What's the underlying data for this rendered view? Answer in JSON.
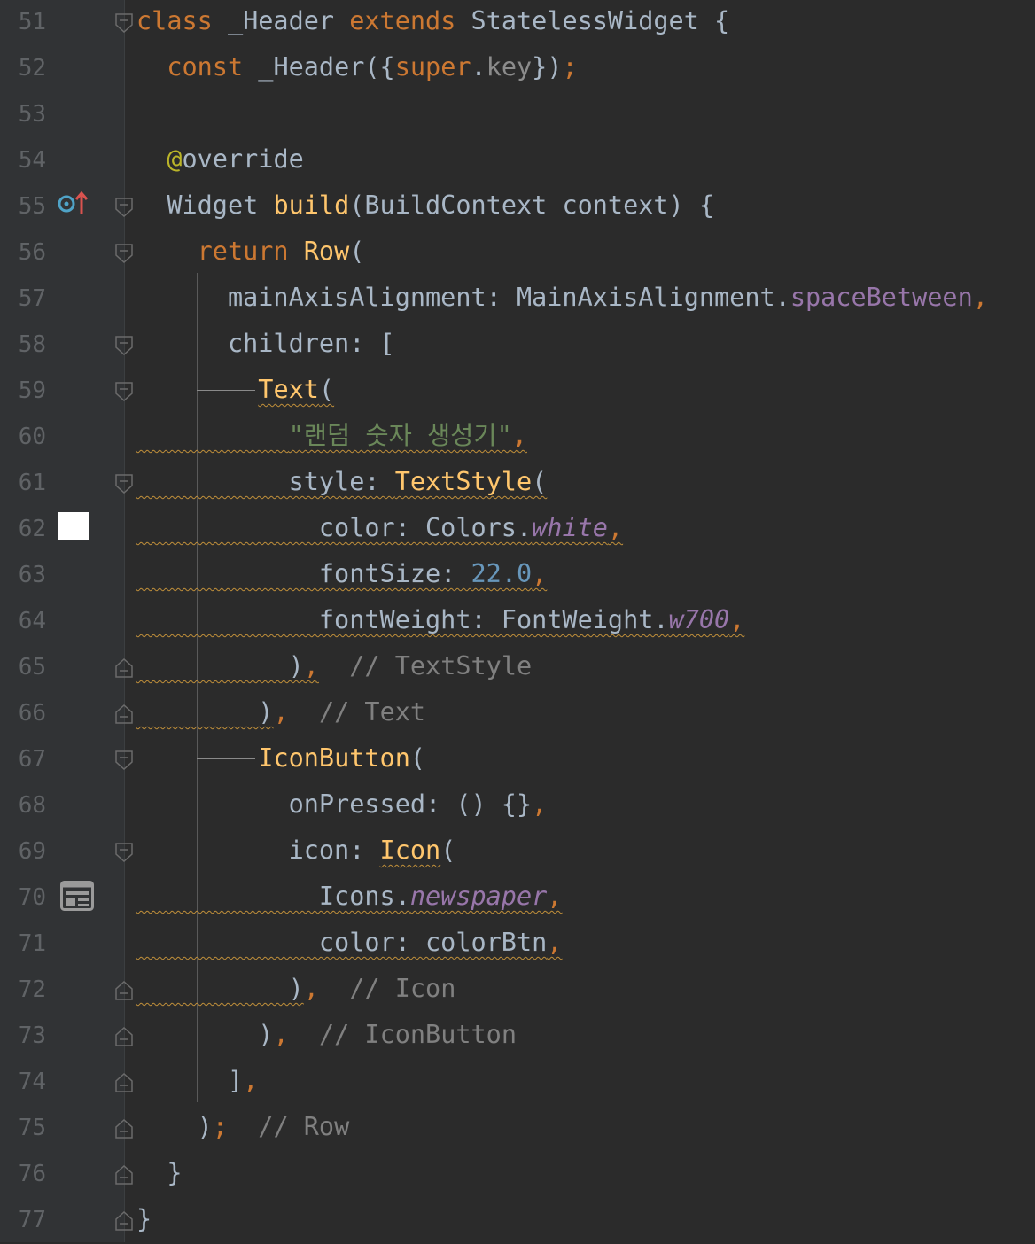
{
  "editor": {
    "language": "dart",
    "lines": [
      {
        "number": "51",
        "tokens": [
          [
            "cls_kw",
            "class"
          ],
          [
            "plain",
            " _Header "
          ],
          [
            "kw",
            "extends"
          ],
          [
            "plain",
            " StatelessWidget {"
          ]
        ]
      },
      {
        "number": "52",
        "tokens": [
          [
            "plain",
            "  "
          ],
          [
            "kw",
            "const"
          ],
          [
            "plain",
            " _Header({"
          ],
          [
            "kw",
            "super"
          ],
          [
            "plain",
            "."
          ],
          [
            "grey",
            "key"
          ],
          [
            "plain",
            "})"
          ],
          [
            "punc",
            ";"
          ]
        ]
      },
      {
        "number": "53",
        "tokens": []
      },
      {
        "number": "54",
        "tokens": [
          [
            "plain",
            "  "
          ],
          [
            "anno",
            "@"
          ],
          [
            "plain",
            "override"
          ]
        ]
      },
      {
        "number": "55",
        "tokens": [
          [
            "plain",
            "  Widget "
          ],
          [
            "cls",
            "build"
          ],
          [
            "plain",
            "(BuildContext context) {"
          ]
        ]
      },
      {
        "number": "56",
        "tokens": [
          [
            "plain",
            "    "
          ],
          [
            "kw",
            "return"
          ],
          [
            "plain",
            " "
          ],
          [
            "cls",
            "Row"
          ],
          [
            "plain",
            "("
          ]
        ]
      },
      {
        "number": "57",
        "tokens": [
          [
            "plain",
            "      mainAxisAlignment: MainAxisAlignment."
          ],
          [
            "field",
            "spaceBetween"
          ],
          [
            "punc",
            ","
          ]
        ]
      },
      {
        "number": "58",
        "tokens": [
          [
            "plain",
            "      children: ["
          ]
        ]
      },
      {
        "number": "59",
        "tokens": [
          [
            "plain",
            "        "
          ],
          [
            "cls_sq",
            "Text"
          ],
          [
            "plain_sq",
            "("
          ]
        ]
      },
      {
        "number": "60",
        "tokens": [
          [
            "plain_sq",
            "          "
          ],
          [
            "str_sq",
            "\"랜덤 숫자 생성기\""
          ],
          [
            "punc_sq",
            ","
          ]
        ]
      },
      {
        "number": "61",
        "tokens": [
          [
            "plain_sq",
            "          style: "
          ],
          [
            "cls_sq",
            "TextStyle"
          ],
          [
            "plain_sq",
            "("
          ]
        ]
      },
      {
        "number": "62",
        "tokens": [
          [
            "plain_sq",
            "            color: Colors."
          ],
          [
            "fieldi_sq",
            "white"
          ],
          [
            "punc_sq",
            ","
          ]
        ]
      },
      {
        "number": "63",
        "tokens": [
          [
            "plain_sq",
            "            fontSize: "
          ],
          [
            "num_sq",
            "22.0"
          ],
          [
            "punc_sq",
            ","
          ]
        ]
      },
      {
        "number": "64",
        "tokens": [
          [
            "plain_sq",
            "            fontWeight: FontWeight."
          ],
          [
            "fieldi_sq",
            "w700"
          ],
          [
            "punc_sq",
            ","
          ]
        ]
      },
      {
        "number": "65",
        "tokens": [
          [
            "plain_sq",
            "          )"
          ],
          [
            "punc_sq",
            ","
          ],
          [
            "plain",
            "  "
          ],
          [
            "cmt",
            "// TextStyle"
          ]
        ]
      },
      {
        "number": "66",
        "tokens": [
          [
            "plain_sq",
            "        )"
          ],
          [
            "punc",
            ","
          ],
          [
            "plain",
            "  "
          ],
          [
            "cmt",
            "// Text"
          ]
        ]
      },
      {
        "number": "67",
        "tokens": [
          [
            "plain",
            "        "
          ],
          [
            "cls",
            "IconButton"
          ],
          [
            "plain",
            "("
          ]
        ]
      },
      {
        "number": "68",
        "tokens": [
          [
            "plain",
            "          onPressed: () {}"
          ],
          [
            "punc",
            ","
          ]
        ]
      },
      {
        "number": "69",
        "tokens": [
          [
            "plain",
            "          icon: "
          ],
          [
            "cls_sq",
            "Icon"
          ],
          [
            "plain",
            "("
          ]
        ]
      },
      {
        "number": "70",
        "tokens": [
          [
            "plain_sq",
            "            Icons."
          ],
          [
            "fieldi_sq",
            "newspaper"
          ],
          [
            "punc_sq",
            ","
          ]
        ]
      },
      {
        "number": "71",
        "tokens": [
          [
            "plain_sq",
            "            color: colorBtn"
          ],
          [
            "punc_sq",
            ","
          ]
        ]
      },
      {
        "number": "72",
        "tokens": [
          [
            "plain_sq",
            "          )"
          ],
          [
            "punc",
            ","
          ],
          [
            "plain",
            "  "
          ],
          [
            "cmt",
            "// Icon"
          ]
        ]
      },
      {
        "number": "73",
        "tokens": [
          [
            "plain",
            "        )"
          ],
          [
            "punc",
            ","
          ],
          [
            "plain",
            "  "
          ],
          [
            "cmt",
            "// IconButton"
          ]
        ]
      },
      {
        "number": "74",
        "tokens": [
          [
            "plain",
            "      ]"
          ],
          [
            "punc",
            ","
          ]
        ]
      },
      {
        "number": "75",
        "tokens": [
          [
            "plain",
            "    )"
          ],
          [
            "punc",
            ";"
          ],
          [
            "plain",
            "  "
          ],
          [
            "cmt",
            "// Row"
          ]
        ]
      },
      {
        "number": "76",
        "tokens": [
          [
            "plain",
            "  }"
          ]
        ]
      },
      {
        "number": "77",
        "tokens": [
          [
            "plain",
            "}"
          ]
        ]
      }
    ]
  },
  "gutter_icons": {
    "override_marker": "override-up-arrow-icon",
    "color_swatch": "#ffffff",
    "icon_preview": "newspaper-icon"
  },
  "theme": {
    "background": "#2b2b2b",
    "gutter_background": "#313335",
    "keyword": "#cc7832",
    "function": "#ffc66d",
    "string": "#6a8759",
    "number": "#6897bb",
    "field": "#9876aa",
    "comment": "#808080",
    "annotation": "#bbb529",
    "text": "#a9b7c6",
    "line_number": "#606366"
  }
}
